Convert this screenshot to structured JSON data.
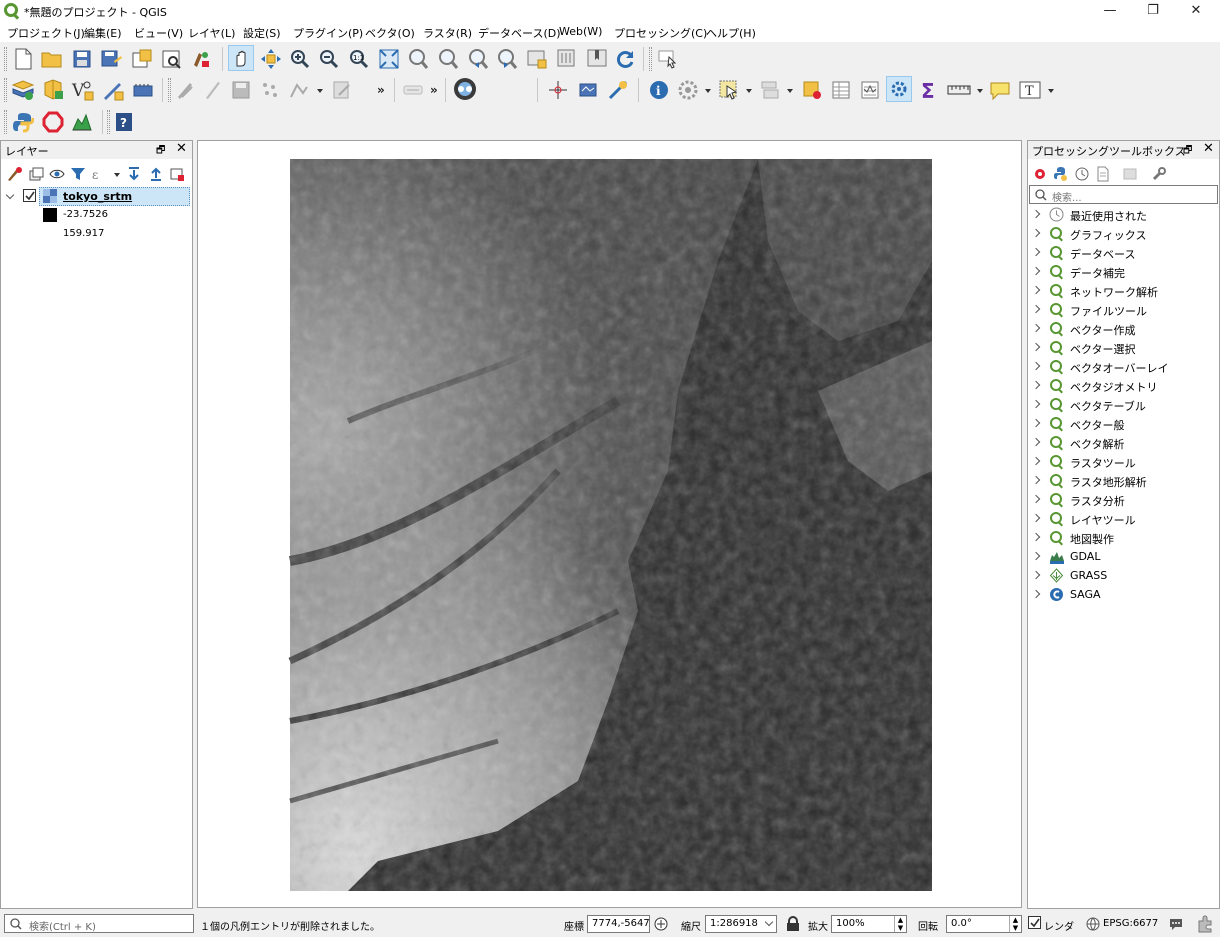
{
  "window": {
    "title": "*無題のプロジェクト - QGIS",
    "minimize": "—",
    "maximize": "❐",
    "close": "✕"
  },
  "menu": [
    "プロジェクト(J)",
    "編集(E)",
    "ビュー(V)",
    "レイヤ(L)",
    "設定(S)",
    "プラグイン(P)",
    "ベクタ(O)",
    "ラスタ(R)",
    "データベース(D)",
    "Web(W)",
    "プロセッシング(C)",
    "ヘルプ(H)"
  ],
  "toolbar": {
    "overflow": "»",
    "text_tool": "T"
  },
  "layers_panel": {
    "title": "レイヤー",
    "float": "🗗",
    "close": "✕",
    "layer": {
      "name": "tokyo_srtm",
      "min_value": "-23.7526",
      "max_value": "159.917"
    }
  },
  "toolbox_panel": {
    "title": "プロセッシングツールボックス",
    "float": "🗗",
    "close": "✕",
    "search_placeholder": "検索...",
    "items": [
      "最近使用された",
      "グラフィックス",
      "データベース",
      "データ補完",
      "ネットワーク解析",
      "ファイルツール",
      "ベクター作成",
      "ベクター選択",
      "ベクタオーバーレイ",
      "ベクタジオメトリ",
      "ベクタテーブル",
      "ベクター般",
      "ベクタ解析",
      "ラスタツール",
      "ラスタ地形解析",
      "ラスタ分析",
      "レイヤツール",
      "地図製作",
      "GDAL",
      "GRASS",
      "SAGA"
    ]
  },
  "statusbar": {
    "search_placeholder": "検索(Ctrl + K)",
    "message": "１個の凡例エントリが削除されました。",
    "coordinate_label": "座標",
    "coordinate_value": "7774,-5647",
    "scale_label": "縮尺",
    "scale_value": "1:286918",
    "magnifier_label": "拡大",
    "magnifier_value": "100%",
    "rotation_label": "回転",
    "rotation_value": "0.0°",
    "render_label": "レンダ",
    "crs": "EPSG:6677"
  },
  "colors": {
    "qgis_green": "#589632",
    "selection_blue": "#cde6f7",
    "raster_dark": "#2b2b2b",
    "raster_light": "#e8e8e8"
  }
}
